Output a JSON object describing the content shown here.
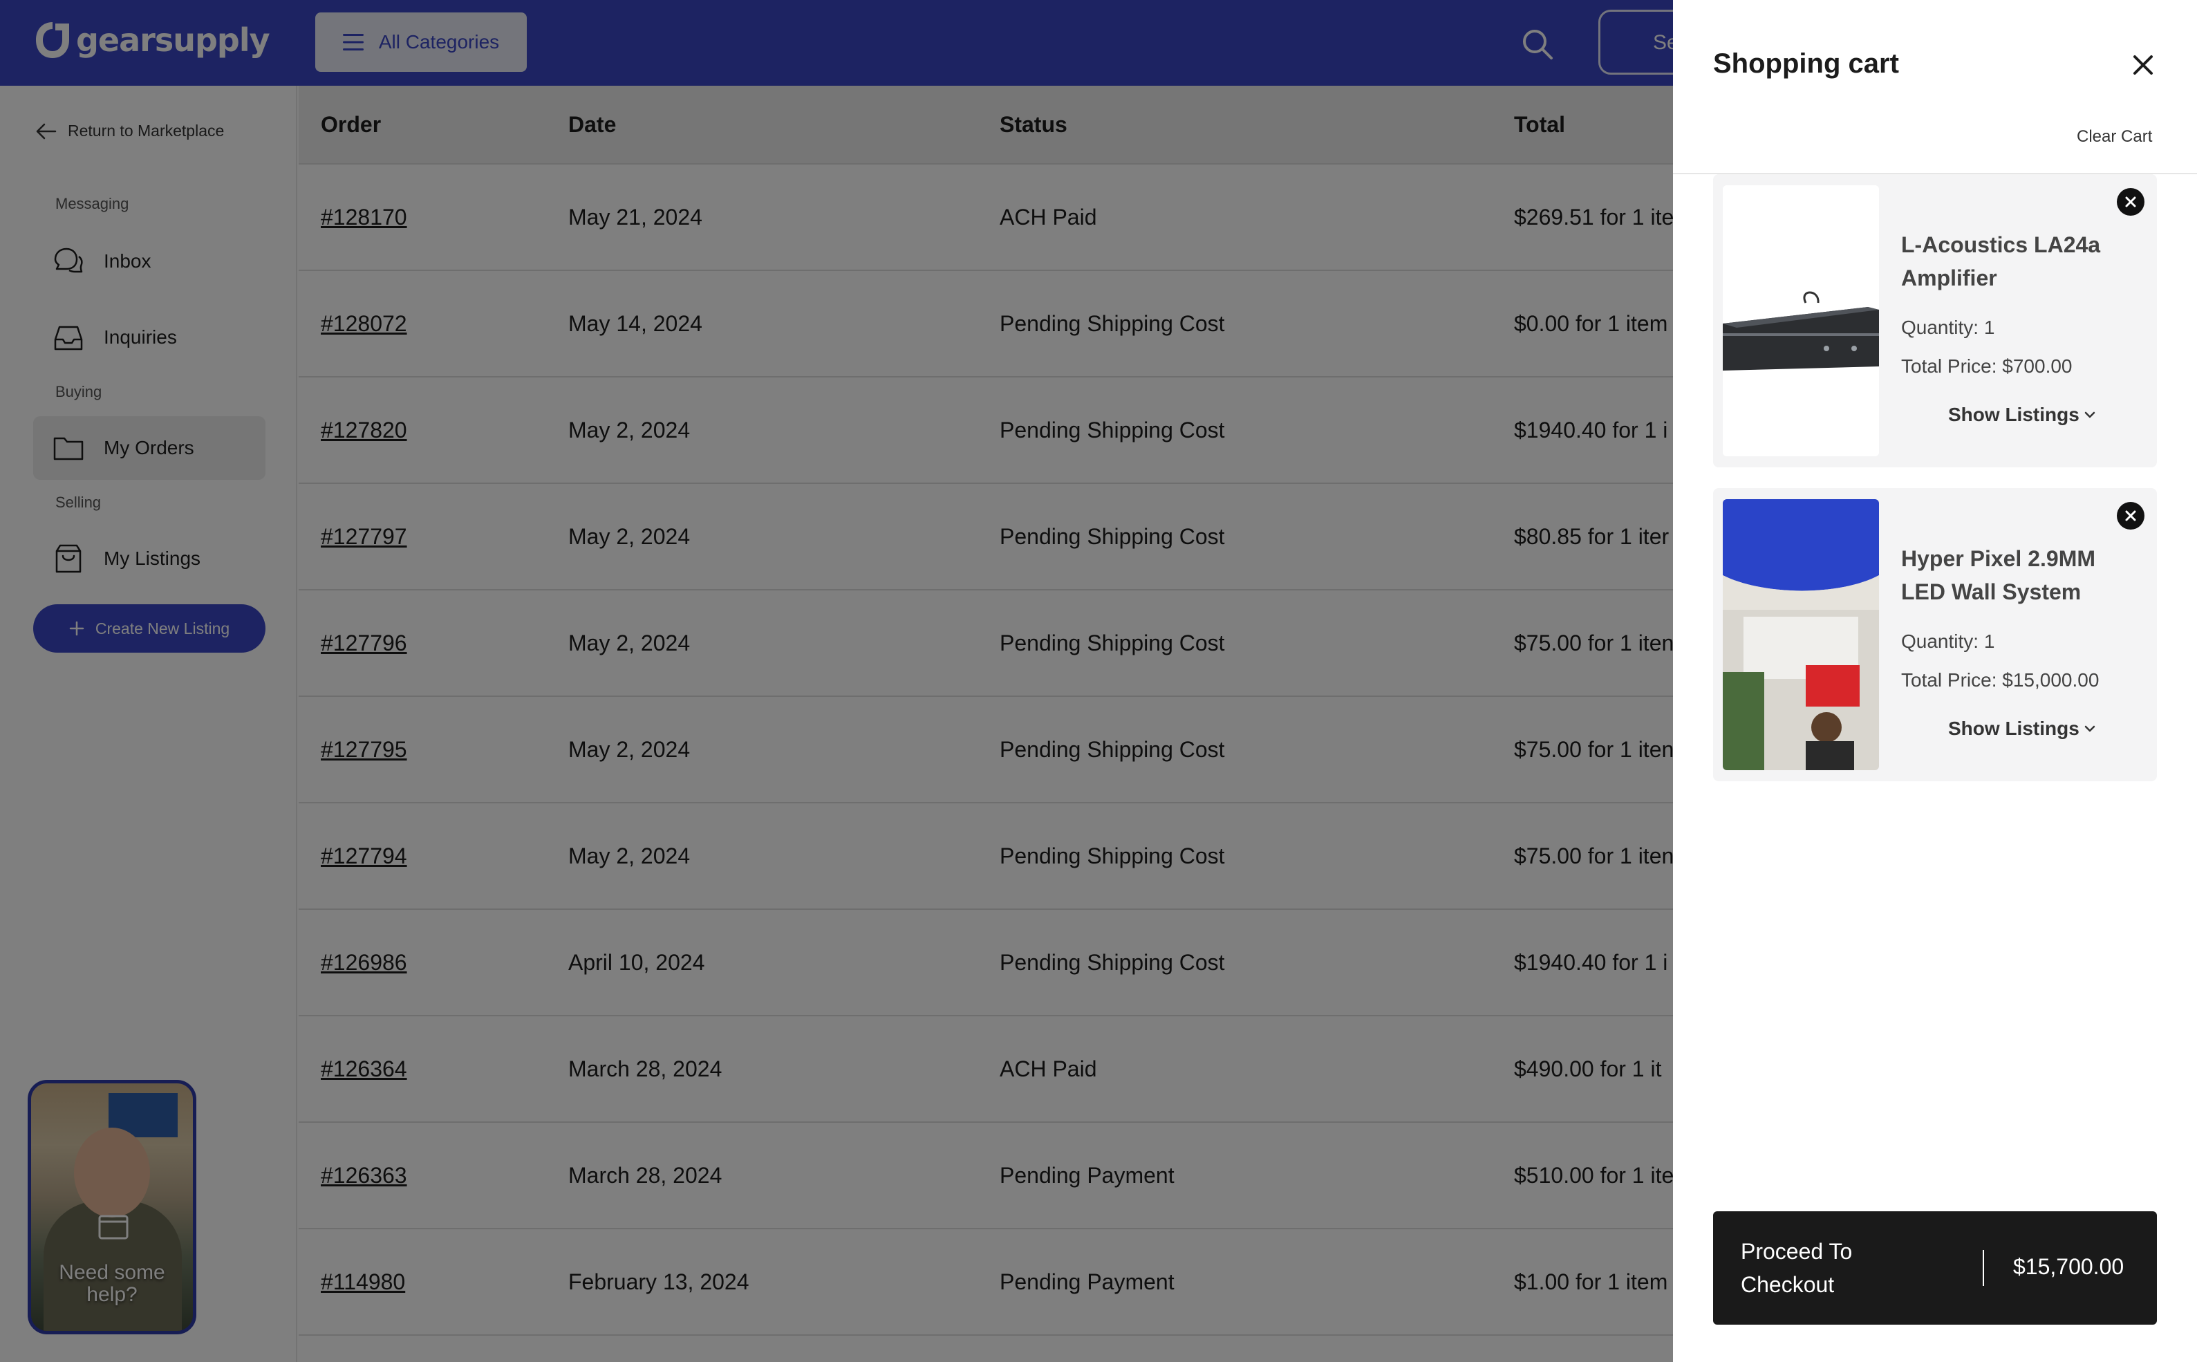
{
  "brand": {
    "name": "gearsupply"
  },
  "header": {
    "categories_label": "All Categories",
    "sell_label": "Se"
  },
  "sidebar": {
    "back_label": "Return to Marketplace",
    "sections": {
      "messaging": "Messaging",
      "buying": "Buying",
      "selling": "Selling"
    },
    "items": {
      "inbox": "Inbox",
      "inquiries": "Inquiries",
      "my_orders": "My Orders",
      "my_listings": "My Listings"
    },
    "create_label": "Create New Listing"
  },
  "help": {
    "text": "Need some help?"
  },
  "orders": {
    "columns": [
      "Order",
      "Date",
      "Status",
      "Total"
    ],
    "rows": [
      {
        "order": "#128170",
        "date": "May 21, 2024",
        "status": "ACH Paid",
        "total": "$269.51 for 1 ite"
      },
      {
        "order": "#128072",
        "date": "May 14, 2024",
        "status": "Pending Shipping Cost",
        "total": "$0.00 for 1 item"
      },
      {
        "order": "#127820",
        "date": "May 2, 2024",
        "status": "Pending Shipping Cost",
        "total": "$1940.40 for 1 i"
      },
      {
        "order": "#127797",
        "date": "May 2, 2024",
        "status": "Pending Shipping Cost",
        "total": "$80.85 for 1 iter"
      },
      {
        "order": "#127796",
        "date": "May 2, 2024",
        "status": "Pending Shipping Cost",
        "total": "$75.00 for 1 iten"
      },
      {
        "order": "#127795",
        "date": "May 2, 2024",
        "status": "Pending Shipping Cost",
        "total": "$75.00 for 1 iten"
      },
      {
        "order": "#127794",
        "date": "May 2, 2024",
        "status": "Pending Shipping Cost",
        "total": "$75.00 for 1 iten"
      },
      {
        "order": "#126986",
        "date": "April 10, 2024",
        "status": "Pending Shipping Cost",
        "total": "$1940.40 for 1 i"
      },
      {
        "order": "#126364",
        "date": "March 28, 2024",
        "status": "ACH Paid",
        "total": "$490.00 for 1 it"
      },
      {
        "order": "#126363",
        "date": "March 28, 2024",
        "status": "Pending Payment",
        "total": "$510.00 for 1 ite"
      },
      {
        "order": "#114980",
        "date": "February 13, 2024",
        "status": "Pending Payment",
        "total": "$1.00 for 1 item"
      }
    ]
  },
  "cart": {
    "title": "Shopping cart",
    "clear_label": "Clear Cart",
    "items": [
      {
        "name": "L-Acoustics LA24a Amplifier",
        "quantity": "Quantity: 1",
        "total": "Total Price: $700.00",
        "show_label": "Show Listings"
      },
      {
        "name": "Hyper Pixel 2.9MM LED Wall System",
        "quantity": "Quantity: 1",
        "total": "Total Price: $15,000.00",
        "show_label": "Show Listings"
      }
    ],
    "checkout_label": "Proceed To Checkout",
    "checkout_total": "$15,700.00"
  },
  "colors": {
    "brand": "#3b47c4",
    "checkout": "#1a1a1a",
    "overlay": "rgba(0,0,0,0.5)"
  },
  "icons": [
    "logo-icon",
    "menu-icon",
    "search-icon",
    "arrow-left-icon",
    "chat-icon",
    "inbox-tray-icon",
    "folder-icon",
    "shopping-bag-icon",
    "plus-icon",
    "close-icon",
    "remove-icon",
    "chevron-down-icon",
    "play-icon"
  ]
}
